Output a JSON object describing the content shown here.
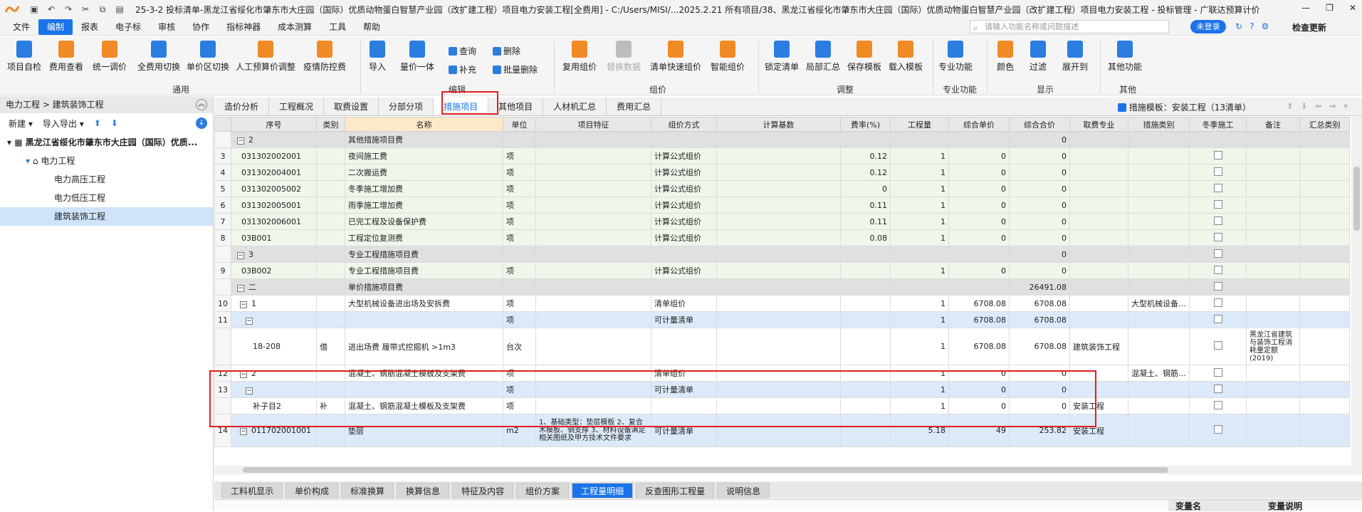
{
  "titlebar": {
    "title": "25-3-2  投标清单-黑龙江省绥化市肇东市大庄园（国际）优质动物蛋白智慧产业园（改扩建工程）项目电力安装工程[全费用] - C:/Users/MISI/...2025.2.21 所有项目/38、黑龙江省绥化市肇东市大庄园（国际）优质动物蛋白智慧产业园（改扩建工程）项目电力安装工程 - 投标管理 - 广联达预算计价",
    "min": "—",
    "max": "❐",
    "close": "✕"
  },
  "menubar": {
    "items": [
      "文件",
      "编制",
      "报表",
      "电子标",
      "审核",
      "协作",
      "指标神器",
      "成本测算",
      "工具",
      "帮助"
    ],
    "search_placeholder": "请输入功能名称或问题描述",
    "login": "未登录",
    "update": "检查更新"
  },
  "ribbon": {
    "b1": "项目自检",
    "b2": "费用查看",
    "b3": "统一调价",
    "b4": "全费用切换",
    "b5": "单价区切换",
    "b6": "人工预算价调整",
    "b7": "疫情防控费",
    "b8": "导入",
    "b9": "量价一体",
    "s1": "查询",
    "s2": "补充",
    "s3": "删除",
    "s4": "批量删除",
    "b10": "复用组价",
    "b11": "替换数据",
    "b12": "清单快速组价",
    "b13": "智能组价",
    "b14": "锁定清单",
    "b15": "局部汇总",
    "b16": "保存模板",
    "b17": "载入模板",
    "b18": "专业功能",
    "b19": "颜色",
    "b20": "过滤",
    "b21": "展开到",
    "b22": "其他功能",
    "g1": "通用",
    "g2": "编辑",
    "g3": "组价",
    "g4": "调整",
    "g5": "专业功能",
    "g6": "显示",
    "g7": "其他"
  },
  "leftpanel": {
    "breadcrumb": "电力工程 > 建筑装饰工程",
    "new": "新建",
    "import": "导入导出",
    "root": "黑龙江省绥化市肇东市大庄园（国际）优质...",
    "node": "电力工程",
    "children": [
      "电力高压工程",
      "电力低压工程",
      "建筑装饰工程"
    ]
  },
  "tabs": {
    "items": [
      "造价分析",
      "工程概况",
      "取费设置",
      "分部分项",
      "措施项目",
      "其他项目",
      "人材机汇总",
      "费用汇总"
    ],
    "template": "措施模板：安装工程（13清单）"
  },
  "table": {
    "headers": [
      "序号",
      "类别",
      "名称",
      "单位",
      "项目特征",
      "组价方式",
      "计算基数",
      "费率(%)",
      "工程量",
      "综合单价",
      "综合合价",
      "取费专业",
      "措施类别",
      "冬季施工",
      "备注",
      "汇总类别"
    ],
    "rows": [
      {
        "rn": "",
        "code": "2",
        "type": "",
        "name": "其他措施项目费",
        "unit": "",
        "feat": "",
        "method": "",
        "base": "",
        "rate": "",
        "qty": "",
        "price": "",
        "total": "0",
        "prof": "",
        "cat": "",
        "note": ""
      },
      {
        "rn": "3",
        "code": "031302002001",
        "type": "",
        "name": "夜间施工费",
        "unit": "项",
        "feat": "",
        "method": "计算公式组价",
        "base": "",
        "rate": "0.12",
        "qty": "1",
        "price": "0",
        "total": "0",
        "prof": "",
        "cat": "",
        "note": ""
      },
      {
        "rn": "4",
        "code": "031302004001",
        "type": "",
        "name": "二次搬运费",
        "unit": "项",
        "feat": "",
        "method": "计算公式组价",
        "base": "",
        "rate": "0.12",
        "qty": "1",
        "price": "0",
        "total": "0",
        "prof": "",
        "cat": "",
        "note": ""
      },
      {
        "rn": "5",
        "code": "031302005002",
        "type": "",
        "name": "冬季施工增加费",
        "unit": "项",
        "feat": "",
        "method": "计算公式组价",
        "base": "",
        "rate": "0",
        "qty": "1",
        "price": "0",
        "total": "0",
        "prof": "",
        "cat": "",
        "note": ""
      },
      {
        "rn": "6",
        "code": "031302005001",
        "type": "",
        "name": "雨季施工增加费",
        "unit": "项",
        "feat": "",
        "method": "计算公式组价",
        "base": "",
        "rate": "0.11",
        "qty": "1",
        "price": "0",
        "total": "0",
        "prof": "",
        "cat": "",
        "note": ""
      },
      {
        "rn": "7",
        "code": "031302006001",
        "type": "",
        "name": "已完工程及设备保护费",
        "unit": "项",
        "feat": "",
        "method": "计算公式组价",
        "base": "",
        "rate": "0.11",
        "qty": "1",
        "price": "0",
        "total": "0",
        "prof": "",
        "cat": "",
        "note": ""
      },
      {
        "rn": "8",
        "code": "03B001",
        "type": "",
        "name": "工程定位复测费",
        "unit": "项",
        "feat": "",
        "method": "计算公式组价",
        "base": "",
        "rate": "0.08",
        "qty": "1",
        "price": "0",
        "total": "0",
        "prof": "",
        "cat": "",
        "note": ""
      },
      {
        "rn": "",
        "code": "3",
        "type": "",
        "name": "专业工程措施项目费",
        "unit": "",
        "feat": "",
        "method": "",
        "base": "",
        "rate": "",
        "qty": "",
        "price": "",
        "total": "0",
        "prof": "",
        "cat": "",
        "note": ""
      },
      {
        "rn": "9",
        "code": "03B002",
        "type": "",
        "name": "专业工程措施项目费",
        "unit": "项",
        "feat": "",
        "method": "计算公式组价",
        "base": "",
        "rate": "",
        "qty": "1",
        "price": "0",
        "total": "0",
        "prof": "",
        "cat": "",
        "note": ""
      },
      {
        "rn": "",
        "code": "二",
        "type": "",
        "name": "单价措施项目费",
        "unit": "",
        "feat": "",
        "method": "",
        "base": "",
        "rate": "",
        "qty": "",
        "price": "",
        "total": "26491.08",
        "prof": "",
        "cat": "",
        "note": ""
      },
      {
        "rn": "10",
        "code": "1",
        "type": "",
        "name": "大型机械设备进出场及安拆费",
        "unit": "项",
        "feat": "",
        "method": "清单组价",
        "base": "",
        "rate": "",
        "qty": "1",
        "price": "6708.08",
        "total": "6708.08",
        "prof": "",
        "cat": "大型机械设备…",
        "note": ""
      },
      {
        "rn": "11",
        "code": "",
        "type": "",
        "name": "",
        "unit": "项",
        "feat": "",
        "method": "可计量清单",
        "base": "",
        "rate": "",
        "qty": "1",
        "price": "6708.08",
        "total": "6708.08",
        "prof": "",
        "cat": "",
        "note": ""
      },
      {
        "rn": "",
        "code": "18-208",
        "type": "借",
        "name": "进出场费 履带式挖掘机 >1m3",
        "unit": "台次",
        "feat": "",
        "method": "",
        "base": "",
        "rate": "",
        "qty": "1",
        "price": "6708.08",
        "total": "6708.08",
        "prof": "建筑装饰工程",
        "cat": "",
        "note": "黑龙江省建筑与装饰工程消耗量定额(2019)"
      },
      {
        "rn": "12",
        "code": "2",
        "type": "",
        "name": "混凝土、钢筋混凝土模板及支架费",
        "unit": "项",
        "feat": "",
        "method": "清单组价",
        "base": "",
        "rate": "",
        "qty": "1",
        "price": "0",
        "total": "0",
        "prof": "",
        "cat": "混凝土、钢筋…",
        "note": ""
      },
      {
        "rn": "13",
        "code": "",
        "type": "",
        "name": "",
        "unit": "项",
        "feat": "",
        "method": "可计量清单",
        "base": "",
        "rate": "",
        "qty": "1",
        "price": "0",
        "total": "0",
        "prof": "",
        "cat": "",
        "note": ""
      },
      {
        "rn": "",
        "code": "补子目2",
        "type": "补",
        "name": "混凝土、钢筋混凝土模板及支架费",
        "unit": "项",
        "feat": "",
        "method": "",
        "base": "",
        "rate": "",
        "qty": "1",
        "price": "0",
        "total": "0",
        "prof": "安装工程",
        "cat": "",
        "note": ""
      },
      {
        "rn": "14",
        "code": "011702001001",
        "type": "",
        "name": "垫层",
        "unit": "m2",
        "feat": "1、基础类型：垫层模板 2、复合木模板、钢支撑 3、材料设备满足相关图纸及甲方技术文件要求",
        "method": "可计量清单",
        "base": "",
        "rate": "",
        "qty": "5.18",
        "price": "49",
        "total": "253.82",
        "prof": "安装工程",
        "cat": "",
        "note": ""
      }
    ]
  },
  "bottomtabs": {
    "items": [
      "工料机显示",
      "单价构成",
      "标准换算",
      "换算信息",
      "特征及内容",
      "组价方案",
      "工程量明细",
      "反查图形工程量",
      "说明信息"
    ]
  },
  "bottompanel": {
    "h1": "变量名",
    "h2": "变量说明"
  },
  "colors": {
    "accent": "#1a73e8",
    "highlight": "#e02020"
  }
}
